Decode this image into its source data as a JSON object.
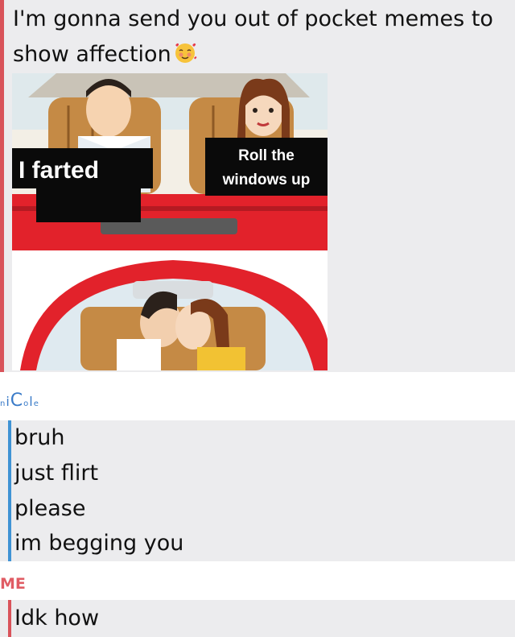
{
  "post": {
    "intro_text": "I'm gonna send you out of pocket memes to show affection"
  },
  "meme": {
    "top_left_label": "I farted",
    "top_right_label": "Roll the windows up"
  },
  "sender_nicole": {
    "name": "niCole"
  },
  "nicole_messages": [
    "bruh",
    "just flirt",
    "please",
    "im begging you"
  ],
  "sender_me": {
    "name": "ME"
  },
  "me_messages": [
    "Idk how"
  ],
  "colors": {
    "nicole_accent": "#3f93d4",
    "me_accent": "#d9535a",
    "bubble_bg": "#ececee"
  }
}
